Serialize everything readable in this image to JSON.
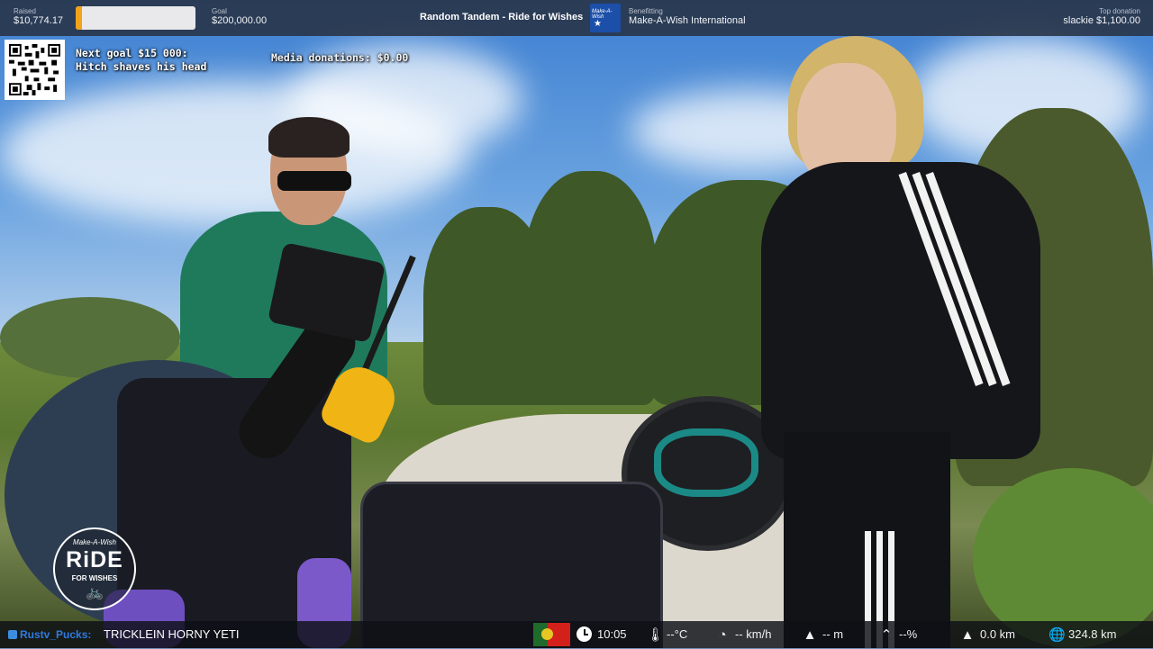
{
  "topbar": {
    "raised_label": "Raised",
    "raised_value": "$10,774.17",
    "progress_fraction": 0.054,
    "progress_color": "#f2a31a",
    "goal_label": "Goal",
    "goal_value": "$200,000.00",
    "stream_title": "Random Tandem - Ride for Wishes",
    "benefit_label": "Benefitting",
    "benefit_org": "Make-A-Wish International",
    "benefit_logo_text": "Make-A-Wish",
    "top_donation_label": "Top donation",
    "top_donation_value": "slackie $1,100.00"
  },
  "overlay": {
    "qr_icon": "qr-code",
    "next_goal_text": "Next goal $15 000: Hitch shaves his head",
    "media_donations": "Media donations: $0.00"
  },
  "ride_logo": {
    "top_text": "Make-A-Wish",
    "main_text": "RiDE",
    "sub_text": "FOR WISHES",
    "icon": "bicycle-icon"
  },
  "bottombar": {
    "chat_user": "Rustv_Pucks:",
    "chat_message": "TRICKLEIN HORNY YETI",
    "country_flag": "portugal-flag",
    "time": "10:05",
    "temperature": "--°C",
    "speed": "-- km/h",
    "elevation": "-- m",
    "incline": "--%",
    "distance_session": "0.0 km",
    "distance_total": "324.8 km"
  }
}
